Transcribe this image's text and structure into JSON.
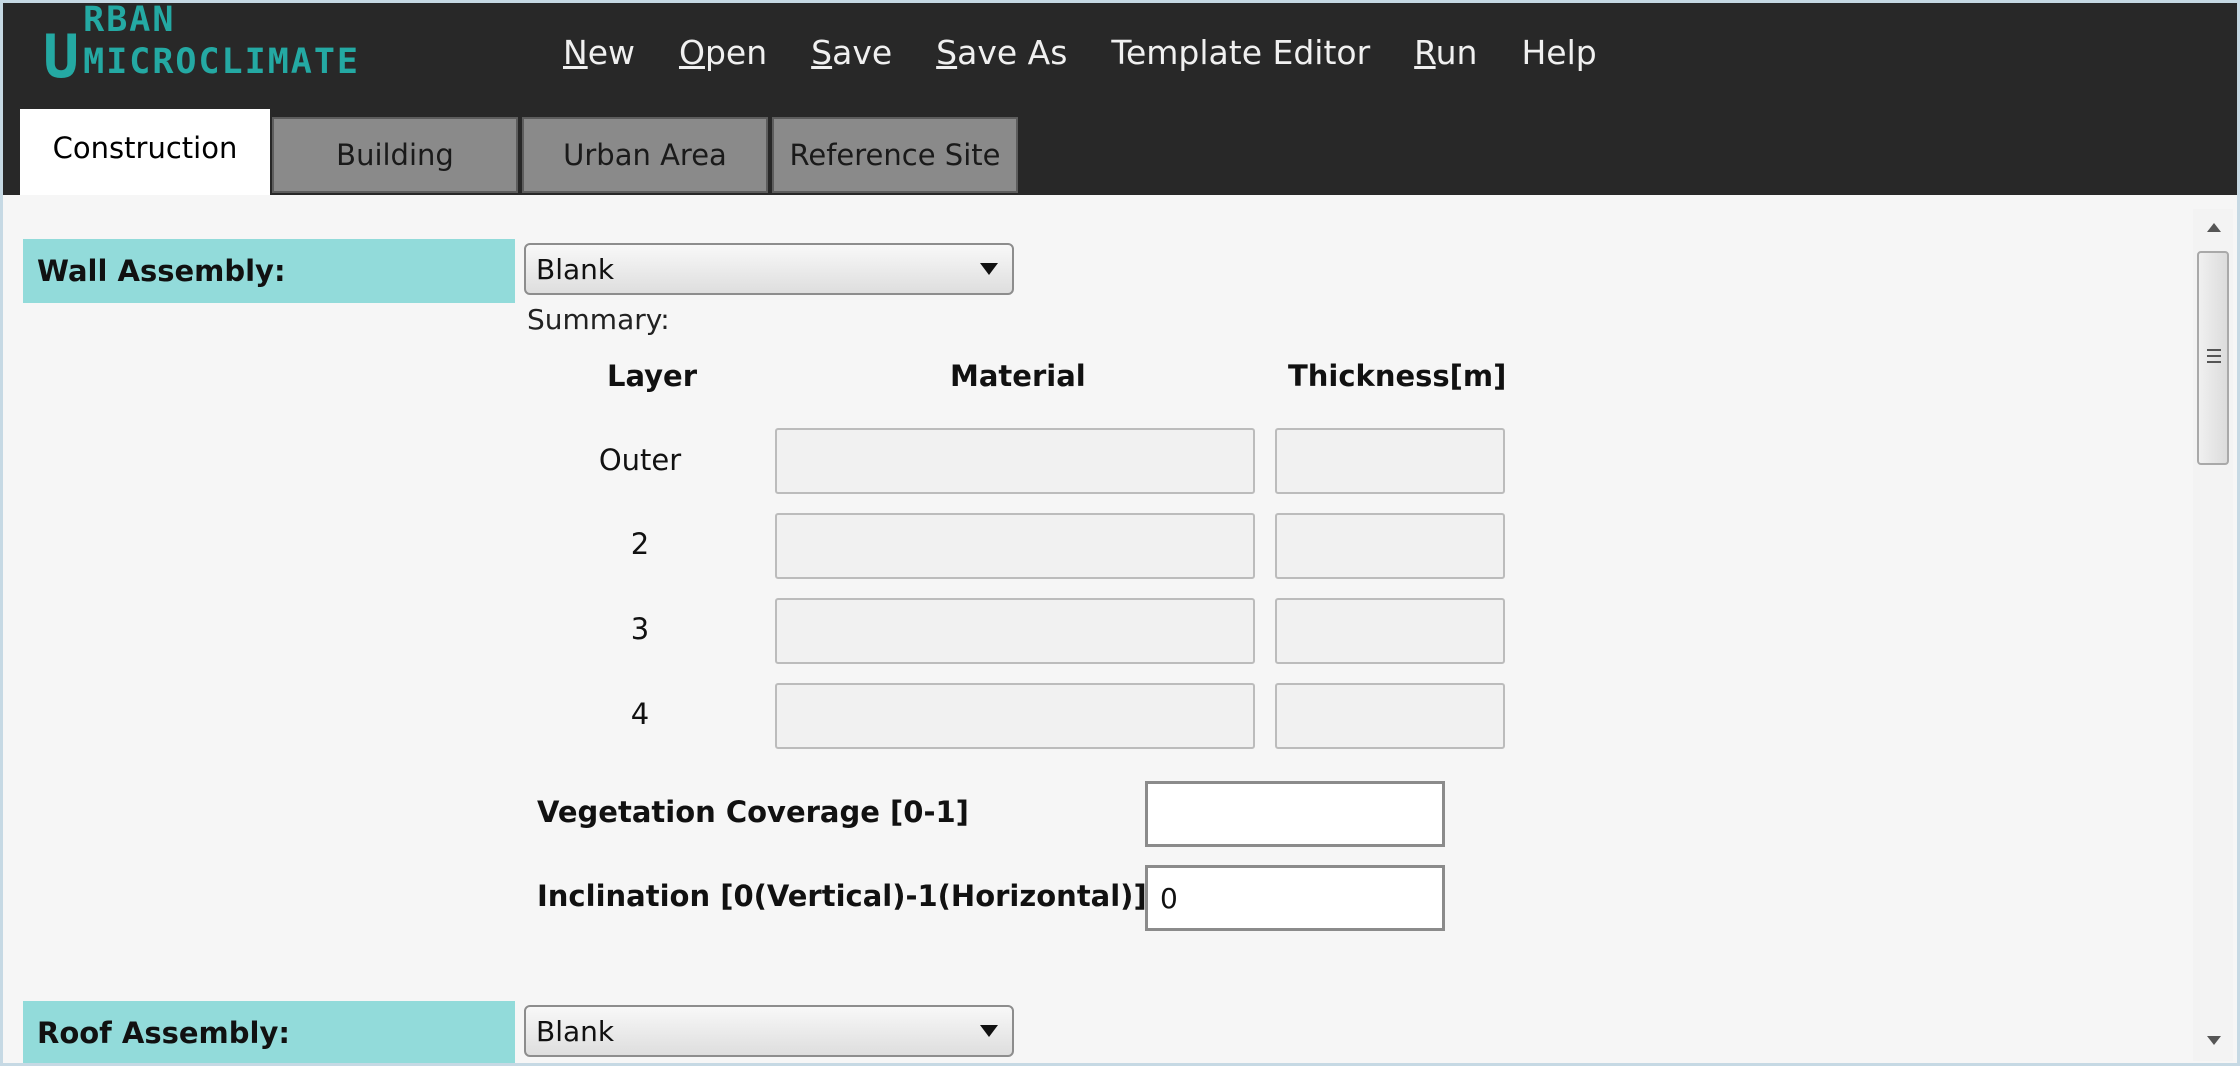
{
  "app": {
    "logo_first": "U",
    "logo_rest": "RBAN MICROCLIMATE",
    "logo_color": "#24a9a3"
  },
  "menu": [
    {
      "u": "N",
      "rest": "ew"
    },
    {
      "u": "O",
      "rest": "pen"
    },
    {
      "u": "S",
      "rest": "ave"
    },
    {
      "u": "S",
      "rest": "ave As"
    },
    {
      "u": "",
      "rest": "Template Editor"
    },
    {
      "u": "R",
      "rest": "un"
    },
    {
      "u": "",
      "rest": "Help"
    }
  ],
  "tabs": [
    "Construction",
    "Building",
    "Urban Area",
    "Reference Site"
  ],
  "active_tab": "Construction",
  "wall": {
    "label": "Wall Assembly:",
    "selected": "Blank",
    "summary_label": "Summary:",
    "columns": [
      "Layer",
      "Material",
      "Thickness[m]"
    ],
    "layers": [
      {
        "layer": "Outer",
        "material": "",
        "thickness": ""
      },
      {
        "layer": "2",
        "material": "",
        "thickness": ""
      },
      {
        "layer": "3",
        "material": "",
        "thickness": ""
      },
      {
        "layer": "4",
        "material": "",
        "thickness": ""
      }
    ],
    "vegetation_label": "Vegetation Coverage [0-1]",
    "vegetation_value": "",
    "inclination_label": "Inclination [0(Vertical)-1(Horizontal)]",
    "inclination_value": "0"
  },
  "roof": {
    "label": "Roof Assembly:",
    "selected": "Blank"
  },
  "colors": {
    "titlebar": "#282828",
    "section_label_bg": "#92dbda"
  }
}
